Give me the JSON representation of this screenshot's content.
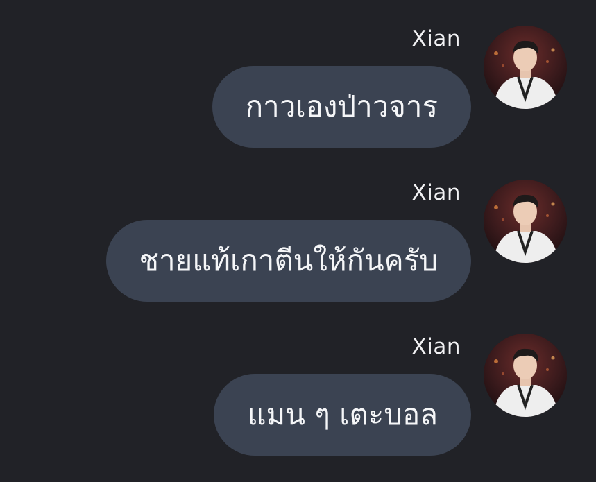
{
  "conversation": {
    "messages": [
      {
        "sender": "Xian",
        "text": "กาวเองป่าวจาร",
        "avatar_icon": "user-photo-avatar"
      },
      {
        "sender": "Xian",
        "text": "ชายแท้เกาตีนให้กันครับ",
        "avatar_icon": "user-photo-avatar"
      },
      {
        "sender": "Xian",
        "text": "แมน ๆ เตะบอล",
        "avatar_icon": "user-photo-avatar"
      }
    ]
  },
  "colors": {
    "background": "#212227",
    "bubble": "#3b4352",
    "text": "#f5f6f8"
  }
}
